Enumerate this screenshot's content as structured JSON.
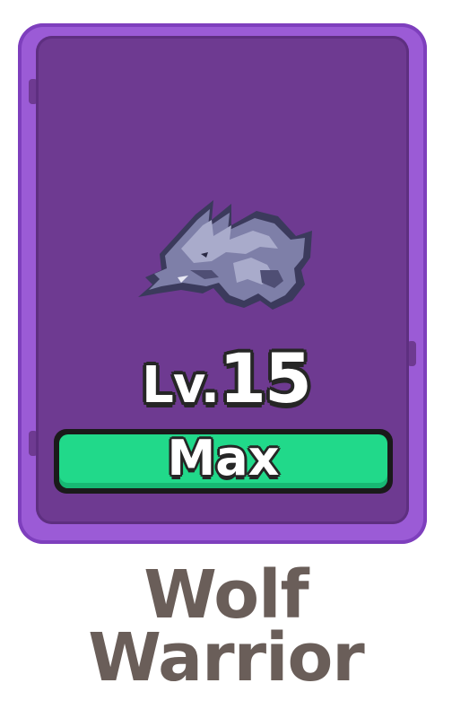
{
  "card": {
    "level_prefix": "Lv.",
    "level_value": "15",
    "status_label": "Max",
    "colors": {
      "frame": "#9b5bd6",
      "panel": "#6e3a91",
      "bar_fill": "#21d98a",
      "outline": "#262626",
      "name_text": "#6a5e59"
    },
    "icon": "wolf-warrior-icon"
  },
  "unit": {
    "name_line1": "Wolf",
    "name_line2": "Warrior"
  }
}
